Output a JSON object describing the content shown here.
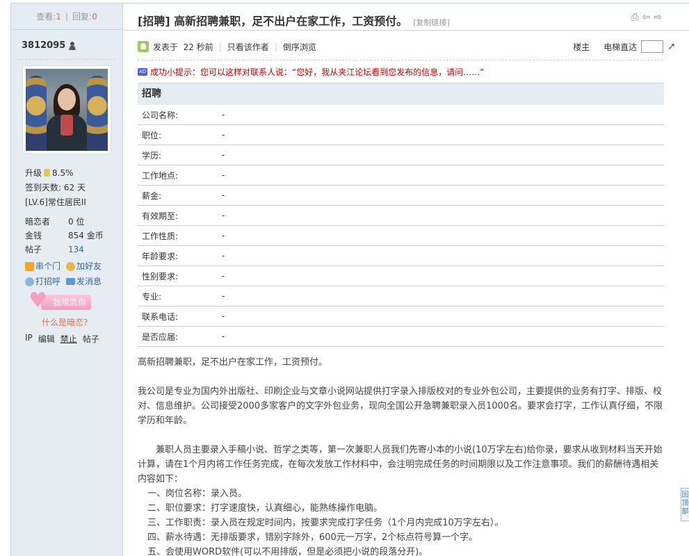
{
  "sidebar": {
    "views_label": "查看:",
    "views_value": "1",
    "replies_label": "回复:",
    "replies_value": "0",
    "username": "3812095",
    "level_label": "升级",
    "level_percent": "8.5%",
    "checkin": "签到天数: 62 天",
    "rank": "[LV.6]常住居民II",
    "stats": [
      {
        "key": "暗恋者",
        "value": "0 位"
      },
      {
        "key": "金钱",
        "value": "854 金币"
      },
      {
        "key": "帖子",
        "value": "134"
      }
    ],
    "actions": {
      "visit": "串个门",
      "add_friend": "加好友",
      "greet": "打招呼",
      "message": "发消息"
    },
    "love_button": "我暗恋你",
    "what_is_love": "什么是暗恋?",
    "ip": "IP",
    "edit": "编辑",
    "ban": "禁止",
    "posts": "帖子"
  },
  "post": {
    "title": "[招聘] 高新招聘兼职，足不出户在家工作，工资预付。",
    "copy_link": "[复制链接]",
    "posted": "发表于",
    "posted_time": "22 秒前",
    "only_author": "只看该作者",
    "reverse": "倒序浏览",
    "floor": "楼主",
    "elevator": "电梯直达",
    "tip": "成功小提示：您可以这样对联系人说：“您好，我从夹江论坛看到您发布的信息，请问……”",
    "ad_badge": "AD"
  },
  "job_table": {
    "heading": "招聘",
    "rows": [
      {
        "label": "公司名称:",
        "value": "-"
      },
      {
        "label": "职位:",
        "value": "-"
      },
      {
        "label": "学历:",
        "value": "-"
      },
      {
        "label": "工作地点:",
        "value": "-"
      },
      {
        "label": "薪金:",
        "value": "-"
      },
      {
        "label": "有效期至:",
        "value": "-"
      },
      {
        "label": "工作性质:",
        "value": "-"
      },
      {
        "label": "年龄要求:",
        "value": "-"
      },
      {
        "label": "性别要求:",
        "value": "-"
      },
      {
        "label": "专业:",
        "value": "-"
      },
      {
        "label": "联系电话:",
        "value": "-"
      },
      {
        "label": "是否应届:",
        "value": "-"
      }
    ]
  },
  "content": {
    "p1": "高新招聘兼职，足不出户在家工作，工资预付。",
    "p2": "我公司是专业为国内外出版社、印刷企业与文章小说网站提供打字录入排版校对的专业外包公司，主要提供的业务有打字、排版、校对、信息维护。公司接受2000多家客户的文字外包业务，现向全国公开急聘兼职录入员1000名。要求会打字，工作认真仔细，不限学历和年龄。",
    "p3": "兼职人员主要录入手稿小说、哲学之类等，第一次兼职人员我们先寄小本的小说(10万字左右)给你录，要求从收到材料当天开始计算，请在1个月内将工作任务完成，在每次发放工作材料中，会注明完成任务的时间期限以及工作注意事项。我们的薪酬待遇相关内容如下：",
    "list": [
      "一、岗位名称：录入员。",
      "二、职位要求：打字速度快，认真细心，能熟练操作电脑。",
      "三、工作职责：录入员在规定时间内，按要求完成打字任务（1个月内完成10万字左右）。",
      "四、薪水待遇：无排版要求，错别字除外，600元一万字，2个标点符号算一个字。",
      "五、会使用WORD软件(可以不用排版，但是必须把小说的段落分开)。"
    ]
  },
  "back_to_top": "回顶部"
}
